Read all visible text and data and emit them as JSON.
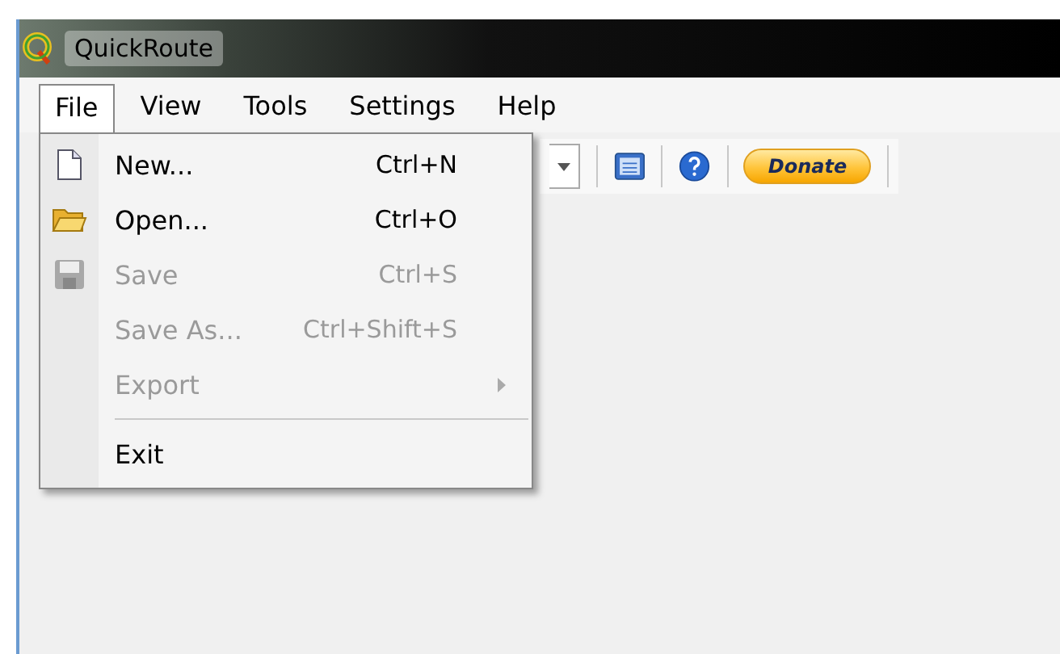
{
  "window": {
    "title": "QuickRoute"
  },
  "menubar": [
    {
      "label": "File",
      "selected": true
    },
    {
      "label": "View",
      "selected": false
    },
    {
      "label": "Tools",
      "selected": false
    },
    {
      "label": "Settings",
      "selected": false
    },
    {
      "label": "Help",
      "selected": false
    }
  ],
  "file_menu": [
    {
      "kind": "item",
      "label": "New...",
      "shortcut": "Ctrl+N",
      "disabled": false
    },
    {
      "kind": "item",
      "label": "Open...",
      "shortcut": "Ctrl+O",
      "disabled": false
    },
    {
      "kind": "item",
      "label": "Save",
      "shortcut": "Ctrl+S",
      "disabled": true
    },
    {
      "kind": "item",
      "label": "Save As...",
      "shortcut": "Ctrl+Shift+S",
      "disabled": true
    },
    {
      "kind": "submenu",
      "label": "Export",
      "disabled": true
    },
    {
      "kind": "separator"
    },
    {
      "kind": "item",
      "label": "Exit",
      "disabled": false
    }
  ],
  "toolbar": {
    "donate": "Donate"
  }
}
